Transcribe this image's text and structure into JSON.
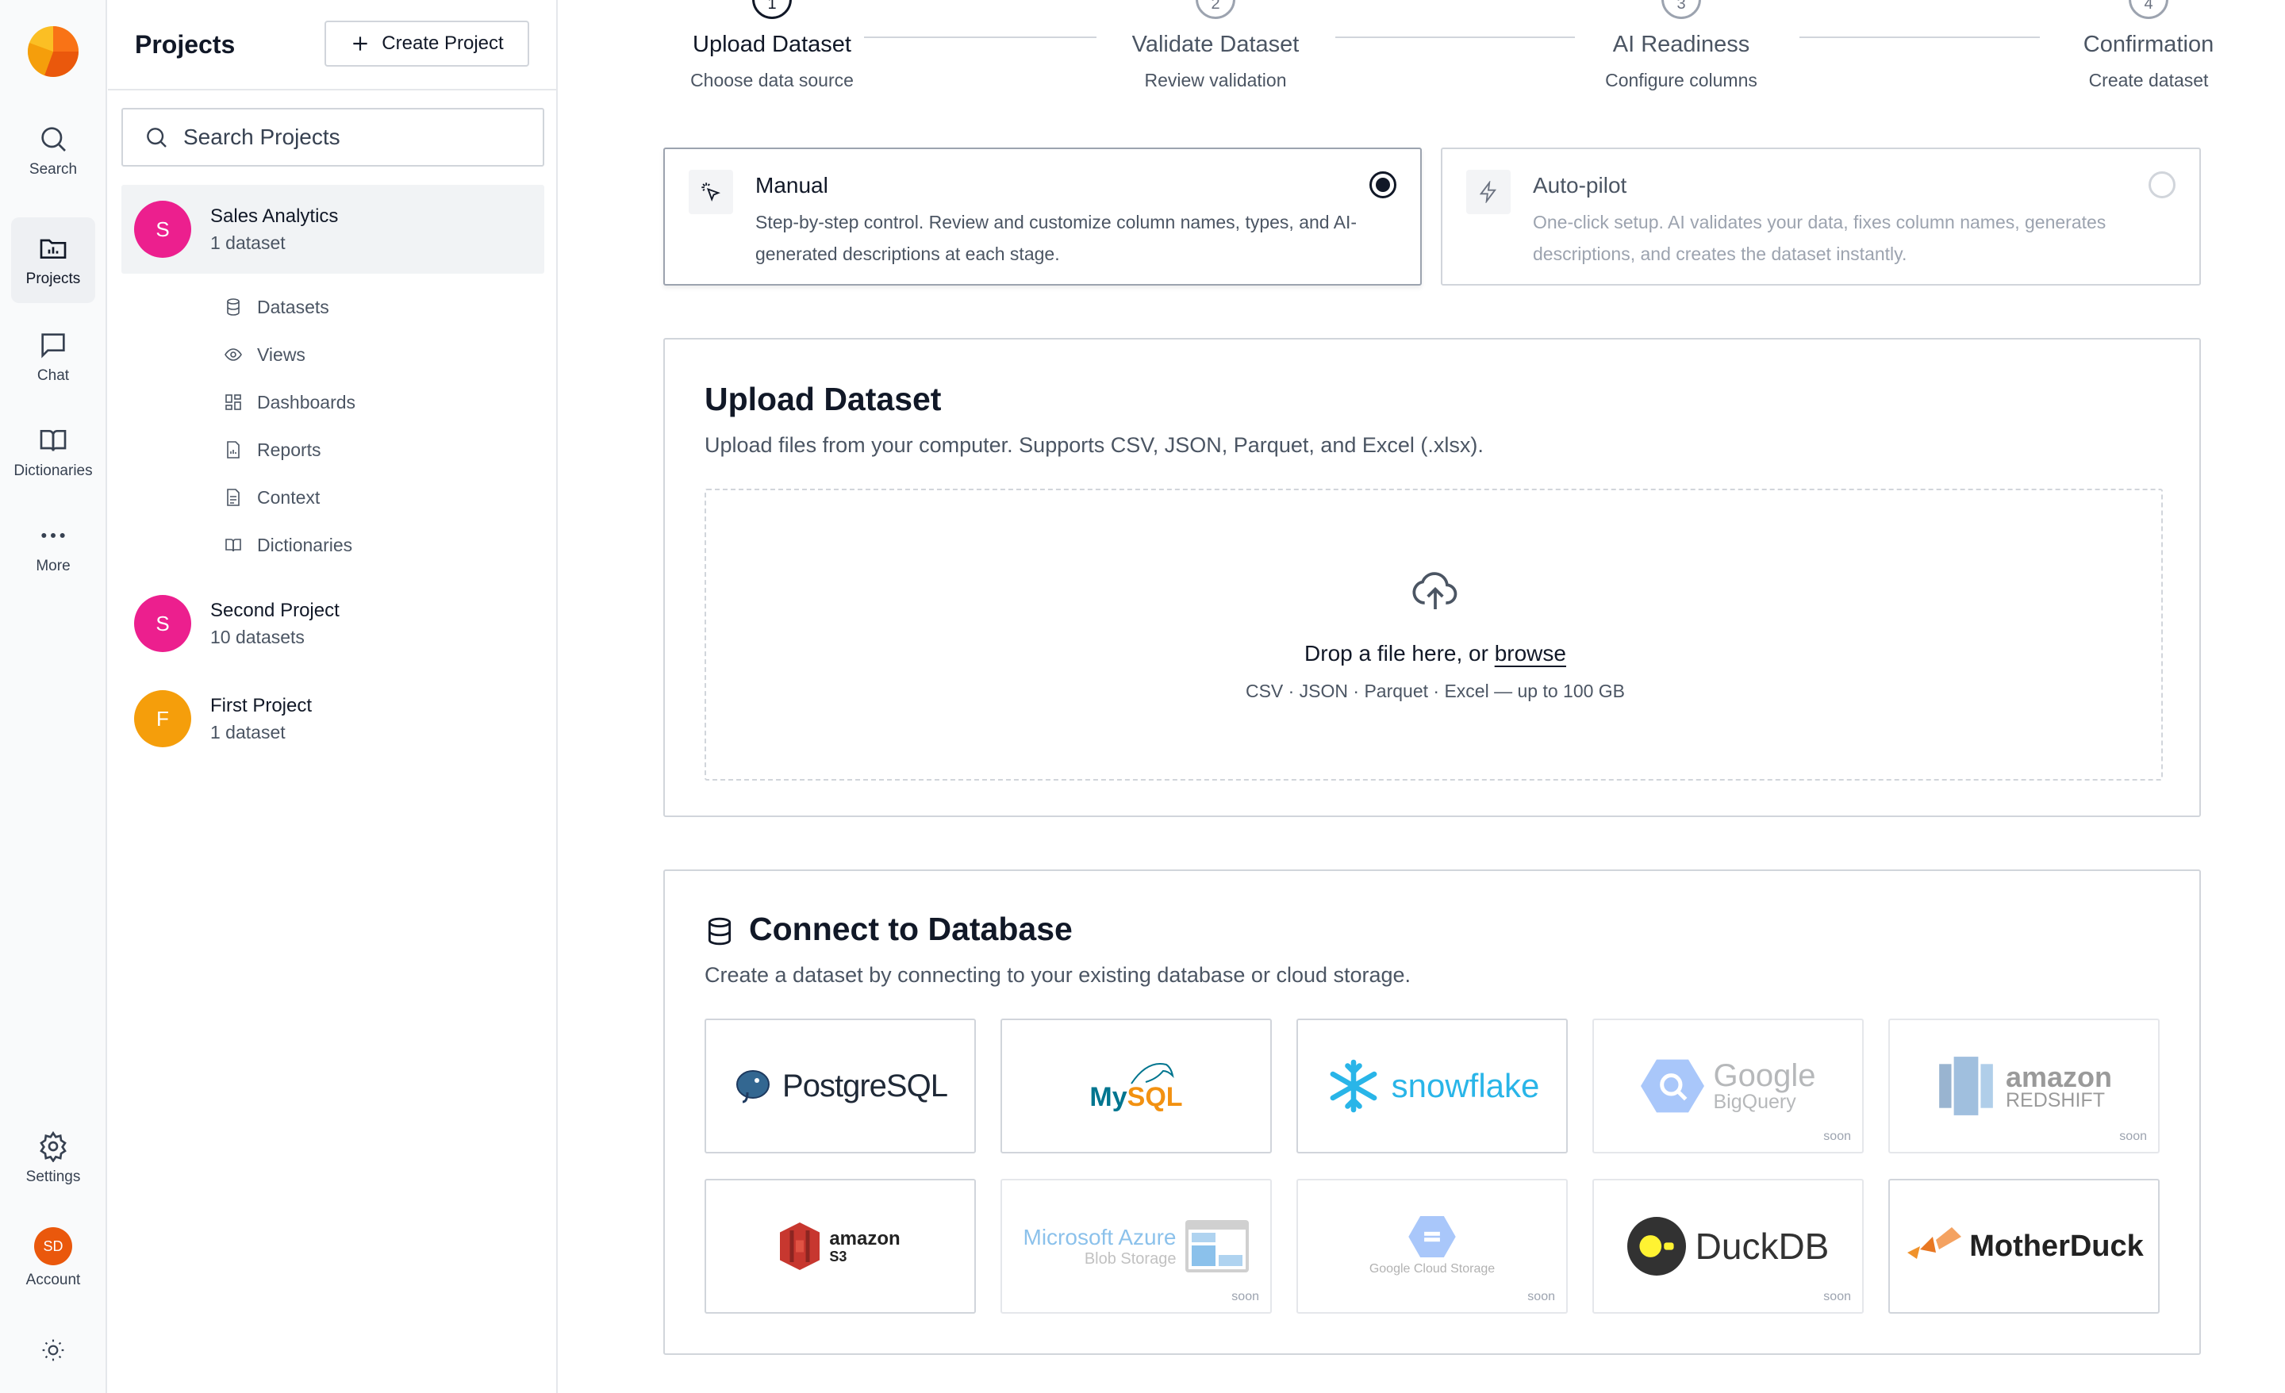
{
  "rail": {
    "items": [
      {
        "label": "Search"
      },
      {
        "label": "Projects"
      },
      {
        "label": "Chat"
      },
      {
        "label": "Dictionaries"
      },
      {
        "label": "More"
      }
    ],
    "settings_label": "Settings",
    "account_initials": "SD",
    "account_label": "Account"
  },
  "panel": {
    "title": "Projects",
    "create_label": "Create Project",
    "search_placeholder": "Search Projects",
    "projects": [
      {
        "initial": "S",
        "name": "Sales Analytics",
        "count": "1 dataset",
        "color": "#ec1f8e"
      },
      {
        "initial": "S",
        "name": "Second Project",
        "count": "10 datasets",
        "color": "#ec1f8e"
      },
      {
        "initial": "F",
        "name": "First Project",
        "count": "1 dataset",
        "color": "#f59e0b"
      }
    ],
    "sub_items": [
      {
        "label": "Datasets",
        "icon": "database-icon"
      },
      {
        "label": "Views",
        "icon": "eye-icon"
      },
      {
        "label": "Dashboards",
        "icon": "dashboard-icon"
      },
      {
        "label": "Reports",
        "icon": "report-icon"
      },
      {
        "label": "Context",
        "icon": "document-icon"
      },
      {
        "label": "Dictionaries",
        "icon": "book-icon"
      }
    ]
  },
  "steps": [
    {
      "num": "1",
      "title": "Upload Dataset",
      "sub": "Choose data source",
      "active": true
    },
    {
      "num": "2",
      "title": "Validate Dataset",
      "sub": "Review validation",
      "active": false
    },
    {
      "num": "3",
      "title": "AI Readiness",
      "sub": "Configure columns",
      "active": false
    },
    {
      "num": "4",
      "title": "Confirmation",
      "sub": "Create dataset",
      "active": false
    }
  ],
  "modes": [
    {
      "title": "Manual",
      "desc": "Step-by-step control. Review and customize column names, types, and AI-generated descriptions at each stage.",
      "selected": true
    },
    {
      "title": "Auto-pilot",
      "desc": "One-click setup. AI validates your data, fixes column names, generates descriptions, and creates the dataset instantly.",
      "selected": false
    }
  ],
  "upload": {
    "title": "Upload Dataset",
    "desc": "Upload files from your computer. Supports CSV, JSON, Parquet, and Excel (.xlsx).",
    "drop_text": "Drop a file here, or",
    "browse_label": "browse",
    "formats": "CSV · JSON · Parquet · Excel — up to 100 GB"
  },
  "connect": {
    "title": "Connect to Database",
    "desc": "Create a dataset by connecting to your existing database or cloud storage.",
    "soon_label": "soon",
    "connectors": [
      {
        "name": "PostgreSQL",
        "soon": false
      },
      {
        "name": "MySQL",
        "name_a": "My",
        "name_b": "SQL",
        "soon": false
      },
      {
        "name": "snowflake",
        "soon": false
      },
      {
        "name": "Google",
        "sub": "BigQuery",
        "soon": true
      },
      {
        "name": "amazon",
        "sub": "REDSHIFT",
        "soon": true
      },
      {
        "name": "amazon",
        "sub": "S3",
        "soon": false
      },
      {
        "name": "Microsoft Azure",
        "sub": "Blob Storage",
        "soon": true
      },
      {
        "name": "Google Cloud Storage",
        "soon": true
      },
      {
        "name": "DuckDB",
        "soon": true
      },
      {
        "name": "MotherDuck",
        "soon": false
      }
    ]
  },
  "colors": {
    "accent": "#111827",
    "postgres_blue": "#336791",
    "mysql_blue": "#00758f",
    "mysql_orange": "#f29111",
    "snowflake": "#29b5e8",
    "bigquery": "#669df6",
    "redshift": "#2e73b8",
    "s3": "#c7372f",
    "motherduck": "#f0922b"
  }
}
